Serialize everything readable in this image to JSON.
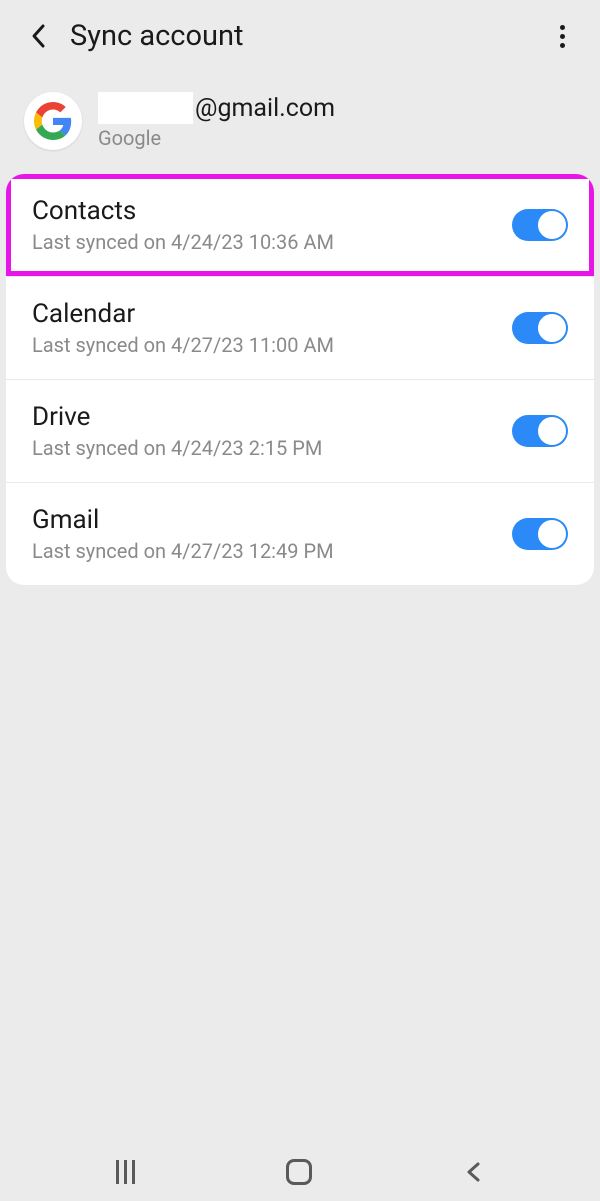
{
  "header": {
    "title": "Sync account"
  },
  "account": {
    "email_suffix": "@gmail.com",
    "provider": "Google"
  },
  "items": [
    {
      "title": "Contacts",
      "sub": "Last synced on 4/24/23  10:36 AM",
      "on": true,
      "highlight": true
    },
    {
      "title": "Calendar",
      "sub": "Last synced on 4/27/23  11:00 AM",
      "on": true
    },
    {
      "title": "Drive",
      "sub": "Last synced on 4/24/23  2:15 PM",
      "on": true
    },
    {
      "title": "Gmail",
      "sub": "Last synced on 4/27/23  12:49 PM",
      "on": true
    }
  ]
}
